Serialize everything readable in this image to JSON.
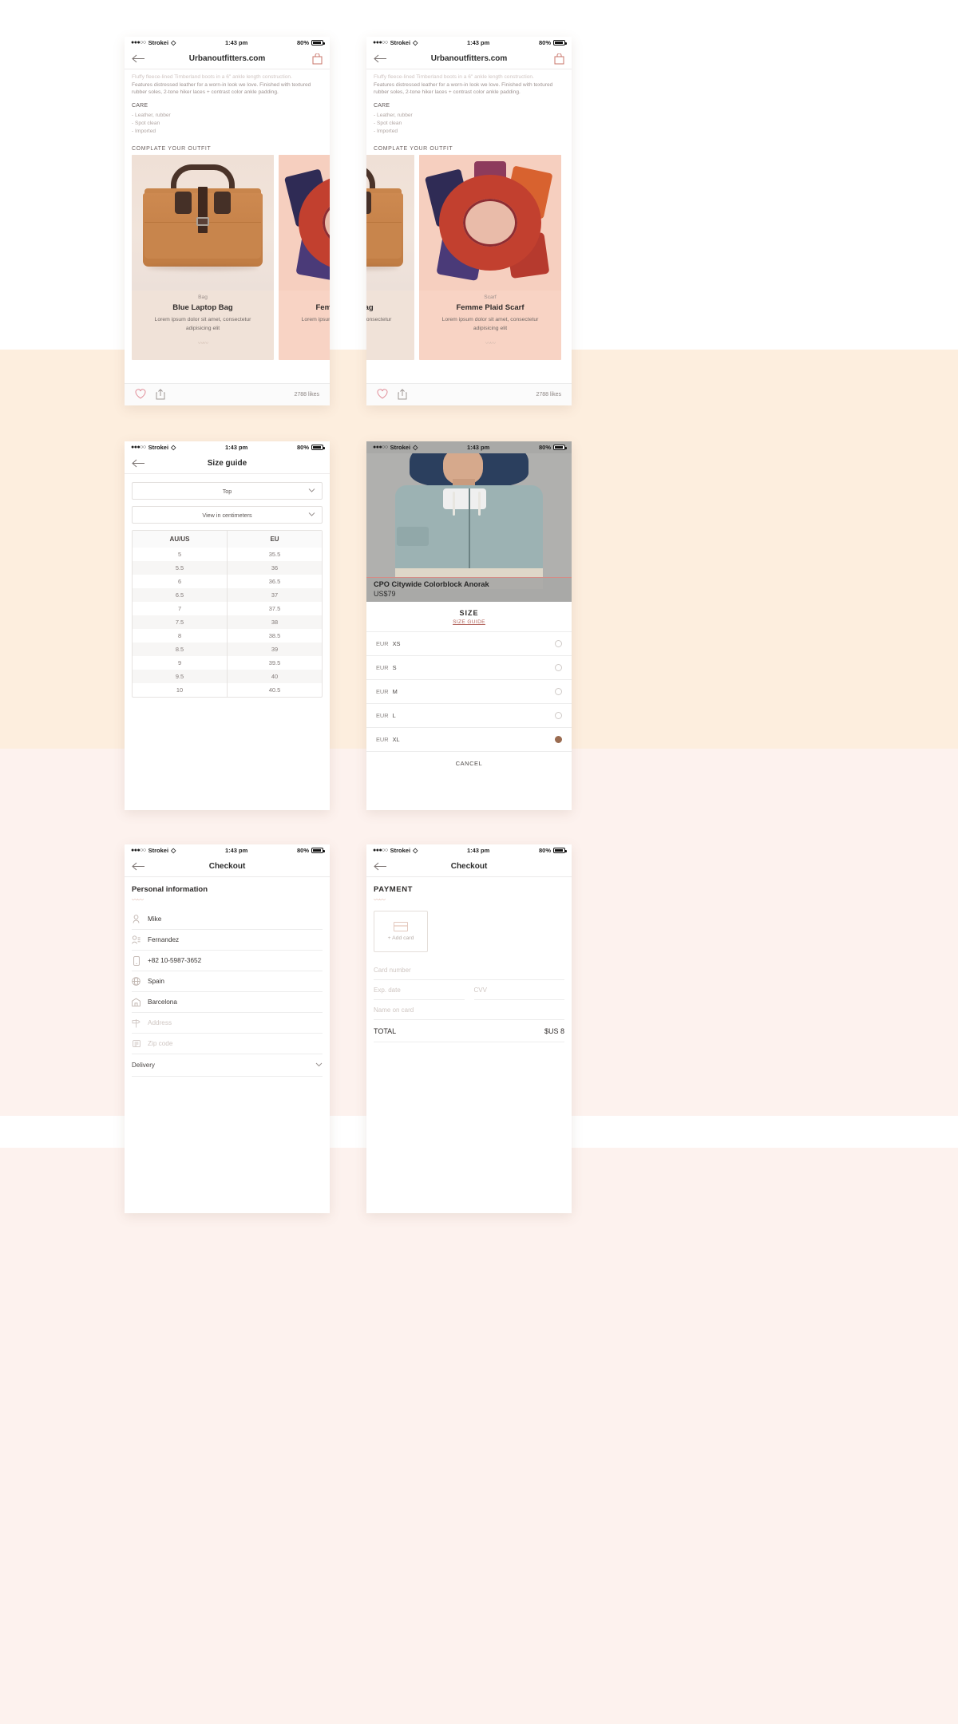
{
  "status_bar": {
    "carrier": "Strokei",
    "time": "1:43 pm",
    "battery": "80%",
    "signal_dots": "●●●○○",
    "wifi_icon": "wifi-icon"
  },
  "screens": {
    "product_left": {
      "nav_title": "Urbanoutfitters.com",
      "back_icon": "back-arrow-icon",
      "bag_icon": "shopping-bag-icon",
      "description_faded": "Fluffy fleece-lined Timberland boots in a 6\" ankle length construction.",
      "description": "Features distressed leather for a worn-in look we love. Finished with textured rubber soles, 2-tone hiker laces + contrast color ankle padding.",
      "care_heading": "CARE",
      "care_items": [
        "- Leather, rubber",
        "- Spot clean",
        "- Imported"
      ],
      "complete_heading": "COMPLATE YOUR OUTFIT",
      "cards": [
        {
          "category": "Bag",
          "name": "Blue Laptop Bag",
          "desc": "Lorem ipsum dolor sit amet, consectetur adipisicing elit"
        },
        {
          "category": "Scarf",
          "name": "Femme Plaid Scarf",
          "desc": "Lorem ipsum dolor sit amet, consectetur adipisicing elit"
        }
      ],
      "heart_icon": "heart-icon",
      "share_icon": "share-icon",
      "likes": "2788 likes"
    },
    "product_right": {
      "nav_title": "Urbanoutfitters.com",
      "scroll_card_clipped_name": "Bag"
    },
    "size_guide": {
      "nav_title": "Size guide",
      "select_category": "Top",
      "select_units": "View in centimeters",
      "columns": [
        "AU/US",
        "EU"
      ],
      "rows": [
        [
          "5",
          "35.5"
        ],
        [
          "5.5",
          "36"
        ],
        [
          "6",
          "36.5"
        ],
        [
          "6.5",
          "37"
        ],
        [
          "7",
          "37.5"
        ],
        [
          "7.5",
          "38"
        ],
        [
          "8",
          "38.5"
        ],
        [
          "8.5",
          "39"
        ],
        [
          "9",
          "39.5"
        ],
        [
          "9.5",
          "40"
        ],
        [
          "10",
          "40.5"
        ]
      ]
    },
    "size_picker": {
      "product_title": "CPO Citywide Colorblock Anorak",
      "product_price": "US$79",
      "section_title": "SIZE",
      "size_guide_link": "SIZE GUIDE",
      "options": [
        {
          "unit": "EUR",
          "size": "XS",
          "selected": false
        },
        {
          "unit": "EUR",
          "size": "S",
          "selected": false
        },
        {
          "unit": "EUR",
          "size": "M",
          "selected": false
        },
        {
          "unit": "EUR",
          "size": "L",
          "selected": false
        },
        {
          "unit": "EUR",
          "size": "XL",
          "selected": true
        }
      ],
      "cancel_label": "CANCEL"
    },
    "checkout_personal": {
      "nav_title": "Checkout",
      "section_title": "Personal information",
      "fields": [
        {
          "icon": "user-icon",
          "value": "Mike",
          "placeholder": false
        },
        {
          "icon": "contact-icon",
          "value": "Fernandez",
          "placeholder": false
        },
        {
          "icon": "phone-icon",
          "value": "+82 10-5987-3652",
          "placeholder": false
        },
        {
          "icon": "globe-icon",
          "value": "Spain",
          "placeholder": false
        },
        {
          "icon": "city-icon",
          "value": "Barcelona",
          "placeholder": false
        },
        {
          "icon": "signpost-icon",
          "value": "Address",
          "placeholder": true
        },
        {
          "icon": "mailbox-icon",
          "value": "Zip code",
          "placeholder": true
        }
      ],
      "delivery_label": "Delivery",
      "delivery_chevron": "chevron-down-icon"
    },
    "checkout_payment": {
      "nav_title": "Checkout",
      "section_title": "PAYMENT",
      "add_card_label": "+ Add card",
      "card_icon": "credit-card-icon",
      "card_number_placeholder": "Card number",
      "exp_placeholder": "Exp. date",
      "cvv_placeholder": "CVV",
      "name_placeholder": "Name on card",
      "total_label": "TOTAL",
      "total_value": "$US 8"
    }
  },
  "colors": {
    "page_peach": "#fdeede",
    "page_rose": "#fdf2ee",
    "card_beige": "#f0e2d8",
    "card_peach": "#f8d3c4",
    "accent_brown": "#9a6b50",
    "link_red": "#b1625a",
    "heart_pink": "#e08b96"
  }
}
